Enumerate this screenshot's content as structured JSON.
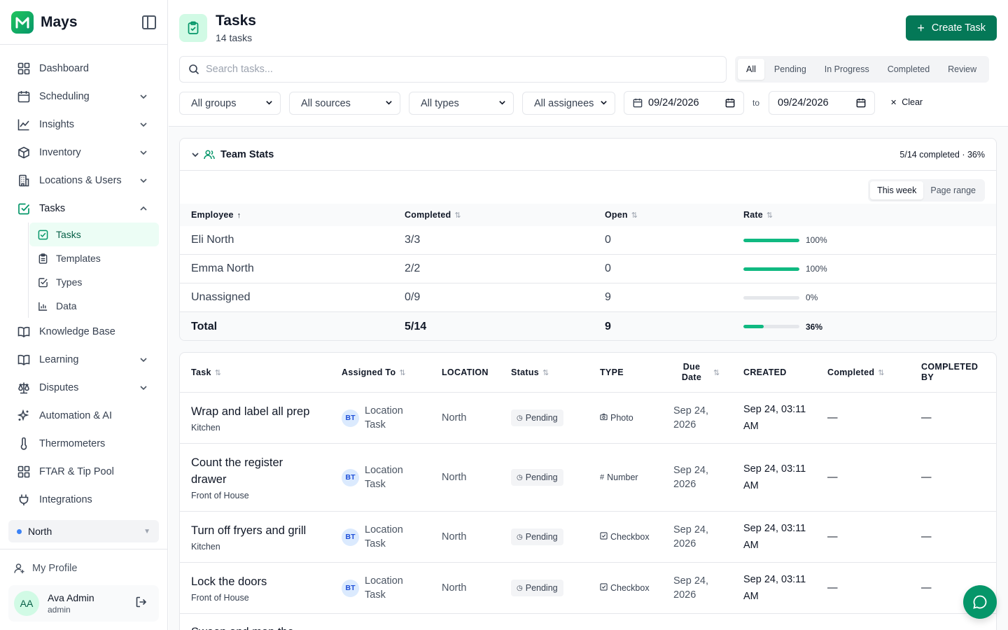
{
  "brand": {
    "name": "Mays",
    "logo_letter": "M"
  },
  "nav": {
    "items": [
      {
        "label": "Dashboard",
        "icon": "grid-icon"
      },
      {
        "label": "Scheduling",
        "icon": "calendar-icon",
        "expandable": true
      },
      {
        "label": "Insights",
        "icon": "line-chart-icon",
        "expandable": true
      },
      {
        "label": "Inventory",
        "icon": "box-icon",
        "expandable": true
      },
      {
        "label": "Locations & Users",
        "icon": "building-icon",
        "expandable": true
      },
      {
        "label": "Tasks",
        "icon": "check-square-icon",
        "expanded": true
      }
    ],
    "tasks_sub": [
      {
        "label": "Tasks",
        "icon": "check-square-icon",
        "active": true
      },
      {
        "label": "Templates",
        "icon": "clipboard-icon"
      },
      {
        "label": "Types",
        "icon": "checkbox-icon"
      },
      {
        "label": "Data",
        "icon": "bar-chart-icon"
      }
    ],
    "items_after": [
      {
        "label": "Knowledge Base",
        "icon": "book-icon"
      },
      {
        "label": "Learning",
        "icon": "book-open-icon",
        "expandable": true
      },
      {
        "label": "Disputes",
        "icon": "scale-icon",
        "expandable": true
      },
      {
        "label": "Automation & AI",
        "icon": "sparkles-icon"
      },
      {
        "label": "Thermometers",
        "icon": "thermometer-icon"
      },
      {
        "label": "FTAR & Tip Pool",
        "icon": "grid-icon"
      },
      {
        "label": "Integrations",
        "icon": "plug-icon"
      }
    ]
  },
  "location": {
    "selected": "North",
    "dot_color": "#3b82f6"
  },
  "profile": {
    "my_profile": "My Profile",
    "initials": "AA",
    "name": "Ava Admin",
    "role": "admin"
  },
  "header": {
    "title": "Tasks",
    "subtitle": "14 tasks",
    "create_label": "Create Task"
  },
  "search": {
    "placeholder": "Search tasks..."
  },
  "status_tabs": [
    "All",
    "Pending",
    "In Progress",
    "Completed",
    "Review"
  ],
  "active_status_tab": "All",
  "filters": {
    "groups": "All groups",
    "sources": "All sources",
    "types": "All types",
    "assignees": "All assignees",
    "date_from": "09/24/2026",
    "to_label": "to",
    "date_to": "09/24/2026",
    "clear_label": "Clear"
  },
  "team_stats": {
    "title": "Team Stats",
    "summary": "5/14 completed · 36%",
    "range_tabs": [
      "This week",
      "Page range"
    ],
    "active_range": "This week",
    "columns": [
      "Employee",
      "Completed",
      "Open",
      "Rate"
    ],
    "rows": [
      {
        "employee": "Eli North",
        "completed": "3/3",
        "open": "0",
        "rate": 1.0,
        "rate_label": "100%"
      },
      {
        "employee": "Emma North",
        "completed": "2/2",
        "open": "0",
        "rate": 1.0,
        "rate_label": "100%"
      },
      {
        "employee": "Unassigned",
        "completed": "0/9",
        "open": "9",
        "rate": 0.0,
        "rate_label": "0%"
      }
    ],
    "total": {
      "employee": "Total",
      "completed": "5/14",
      "open": "9",
      "rate": 0.36,
      "rate_label": "36%"
    }
  },
  "tasks_table": {
    "columns": {
      "task": "Task",
      "assigned": "Assigned To",
      "location": "LOCATION",
      "status": "Status",
      "type": "TYPE",
      "due": "Due Date",
      "created": "CREATED",
      "completed": "Completed",
      "completed_by": "COMPLETED BY"
    },
    "rows": [
      {
        "name": "Wrap and label all prep",
        "group": "Kitchen",
        "assignee_initials": "BT",
        "assignee": "Location Task",
        "location": "North",
        "status": "Pending",
        "type": "Photo",
        "type_icon": "camera-icon",
        "due": "Sep 24, 2026",
        "created": "Sep 24, 03:11 AM",
        "completed": "—",
        "completed_by": "—"
      },
      {
        "name": "Count the register drawer",
        "group": "Front of House",
        "assignee_initials": "BT",
        "assignee": "Location Task",
        "location": "North",
        "status": "Pending",
        "type": "Number",
        "type_icon": "hash-icon",
        "due": "Sep 24, 2026",
        "created": "Sep 24, 03:11 AM",
        "completed": "—",
        "completed_by": "—"
      },
      {
        "name": "Turn off fryers and grill",
        "group": "Kitchen",
        "assignee_initials": "BT",
        "assignee": "Location Task",
        "location": "North",
        "status": "Pending",
        "type": "Checkbox",
        "type_icon": "checkbox-icon",
        "due": "Sep 24, 2026",
        "created": "Sep 24, 03:11 AM",
        "completed": "—",
        "completed_by": "—"
      },
      {
        "name": "Lock the doors",
        "group": "Front of House",
        "assignee_initials": "BT",
        "assignee": "Location Task",
        "location": "North",
        "status": "Pending",
        "type": "Checkbox",
        "type_icon": "checkbox-icon",
        "due": "Sep 24, 2026",
        "created": "Sep 24, 03:11 AM",
        "completed": "—",
        "completed_by": "—"
      },
      {
        "name": "Sweep and mop the",
        "group": "",
        "assignee_initials": "",
        "assignee": "",
        "location": "",
        "status": "",
        "type": "",
        "type_icon": "",
        "due": "",
        "created": "",
        "completed": "",
        "completed_by": ""
      }
    ]
  },
  "colors": {
    "accent": "#047857",
    "accent_light": "#d1fae5",
    "progress": "#10b981"
  }
}
